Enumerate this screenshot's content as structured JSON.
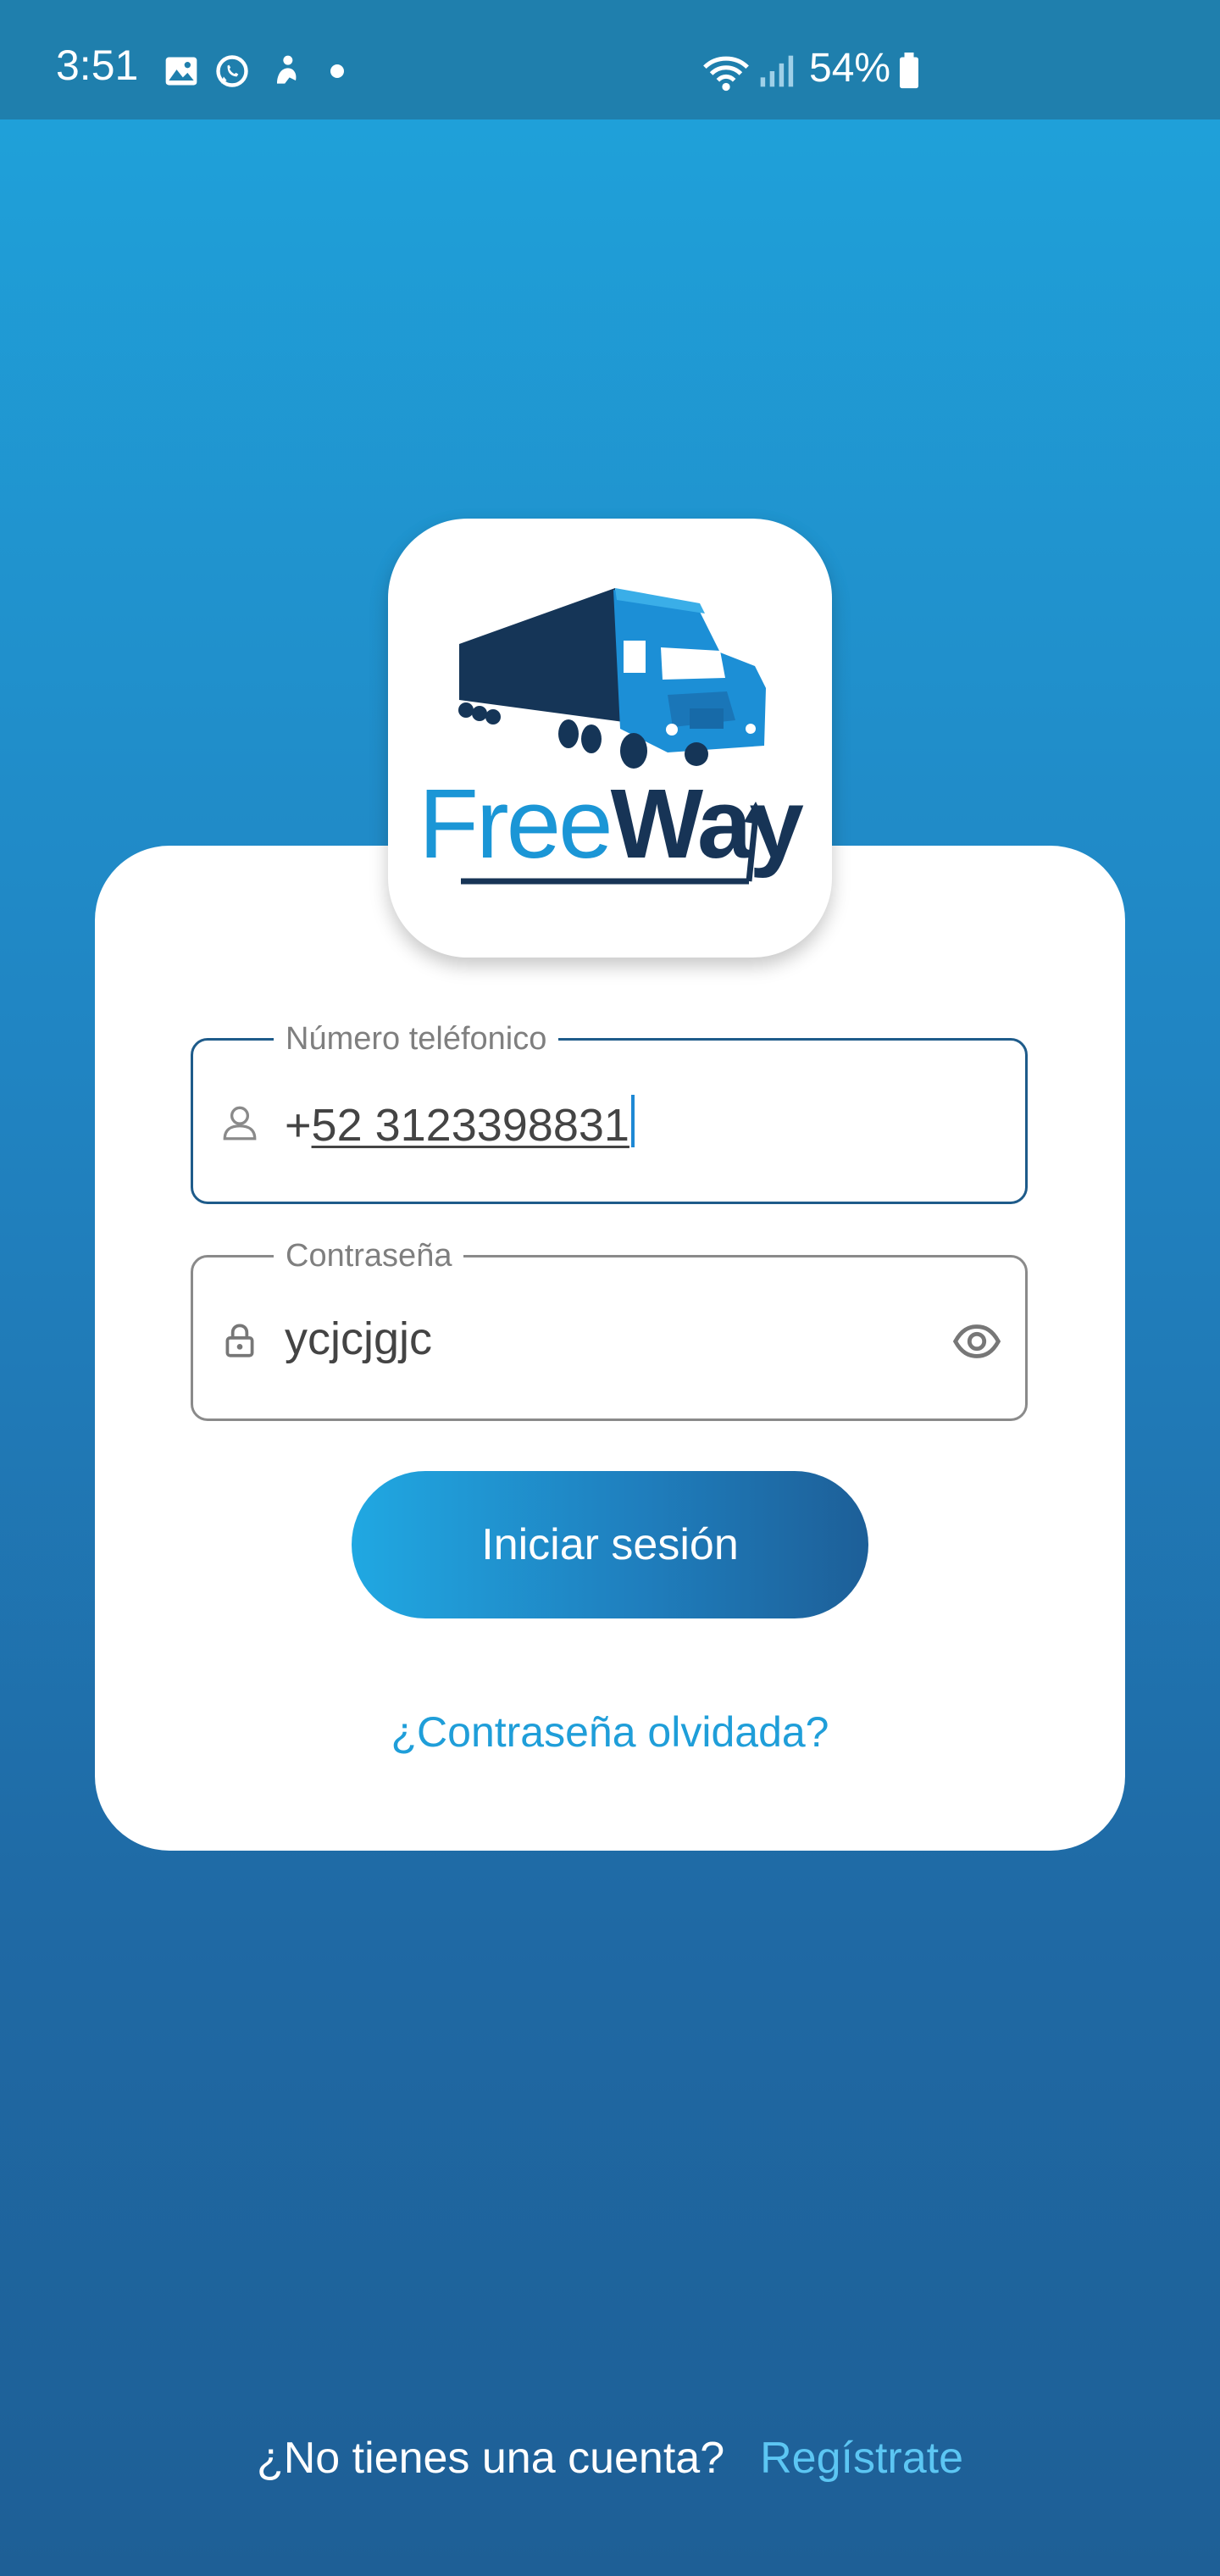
{
  "status_bar": {
    "time": "3:51",
    "notification_icons": [
      "gallery-icon",
      "whatsapp-icon",
      "app-notification-icon",
      "dot-icon"
    ],
    "system_icons": [
      "wifi-icon",
      "signal-icon",
      "battery-icon"
    ],
    "battery": "54%"
  },
  "logo": {
    "brand_part1": "Free",
    "brand_part2": "Way",
    "icon": "truck-icon"
  },
  "login_form": {
    "phone": {
      "label": "Número teléfonico",
      "value_prefix": "+",
      "value_number": "52 3123398831",
      "icon": "person-icon"
    },
    "password": {
      "label": "Contraseña",
      "value": "ycjcjgjc",
      "icon": "lock-icon",
      "toggle_icon": "eye-icon"
    },
    "submit_label": "Iniciar sesión",
    "forgot_label": "¿Contraseña olvidada?"
  },
  "footer": {
    "question": "¿No tienes una cuenta?",
    "register_label": "Regístrate"
  },
  "colors": {
    "background_top": "#1fa4dc",
    "background_bottom": "#1e5f96",
    "brand_dark": "#173456",
    "brand_light": "#1b96d6",
    "link": "#1f9ed9",
    "footer_link": "#5cc6f3"
  }
}
